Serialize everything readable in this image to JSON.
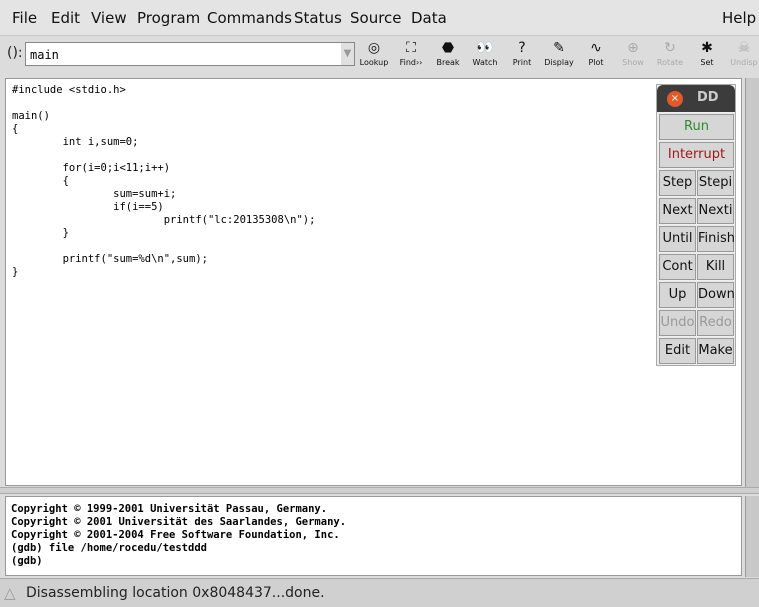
{
  "menu": [
    "File",
    "Edit",
    "View",
    "Program",
    "Commands",
    "Status",
    "Source",
    "Data"
  ],
  "help": "Help",
  "arg": {
    "label": "():",
    "value": "main"
  },
  "tools": [
    {
      "label": "Lookup",
      "icon": "lookup-icon",
      "glyph": "◎",
      "enabled": true
    },
    {
      "label": "Find››",
      "icon": "binoculars-icon",
      "glyph": "⛶",
      "enabled": true
    },
    {
      "label": "Break",
      "icon": "stop-sign-icon",
      "glyph": "⬣",
      "enabled": true
    },
    {
      "label": "Watch",
      "icon": "eyes-icon",
      "glyph": "👀",
      "enabled": true
    },
    {
      "label": "Print",
      "icon": "question-icon",
      "glyph": "?",
      "enabled": true
    },
    {
      "label": "Display",
      "icon": "display-icon",
      "glyph": "✎",
      "enabled": true
    },
    {
      "label": "Plot",
      "icon": "plot-icon",
      "glyph": "∿",
      "enabled": true
    },
    {
      "label": "Show",
      "icon": "magnifier-icon",
      "glyph": "⊕",
      "enabled": false
    },
    {
      "label": "Rotate",
      "icon": "rotate-icon",
      "glyph": "↻",
      "enabled": false
    },
    {
      "label": "Set",
      "icon": "set-icon",
      "glyph": "✱",
      "enabled": true
    },
    {
      "label": "Undisp",
      "icon": "undisplay-icon",
      "glyph": "☠",
      "enabled": false
    }
  ],
  "source": "#include <stdio.h>\n\nmain()\n{\n        int i,sum=0;\n\n        for(i=0;i<11;i++)\n        {\n                sum=sum+i;\n                if(i==5)\n                        printf(\"lc:20135308\\n\");\n        }\n\n        printf(\"sum=%d\\n\",sum);\n}",
  "console": "Copyright © 1999-2001 Universität Passau, Germany.\nCopyright © 2001 Universität des Saarlandes, Germany.\nCopyright © 2001-2004 Free Software Foundation, Inc.\n(gdb) file /home/rocedu/testddd\n(gdb) ",
  "status": "Disassembling location 0x8048437...done.",
  "cmdtool": {
    "title": "DD",
    "run": "Run",
    "interrupt": "Interrupt",
    "pairs": [
      [
        "Step",
        "Stepi"
      ],
      [
        "Next",
        "Nexti"
      ],
      [
        "Until",
        "Finish"
      ],
      [
        "Cont",
        "Kill"
      ],
      [
        "Up",
        "Down"
      ],
      [
        "Undo",
        "Redo"
      ],
      [
        "Edit",
        "Make"
      ]
    ],
    "run_color": "#2e8b2e",
    "interrupt_color": "#a01818"
  }
}
